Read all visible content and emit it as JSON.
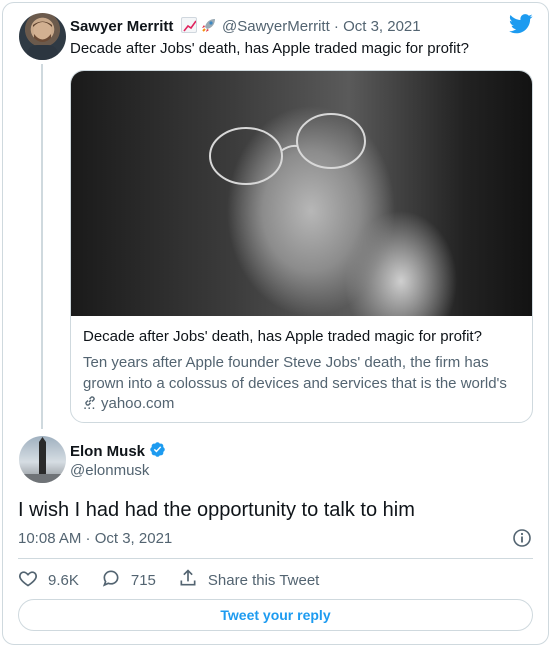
{
  "quoted_tweet": {
    "author_name": "Sawyer Merritt",
    "emoji_icons": [
      "chart-increasing-icon",
      "rocket-icon"
    ],
    "handle_time": "@SawyerMerritt · Oct 3, 2021",
    "text": "Decade after Jobs' death, has Apple traded magic for profit?",
    "link_card": {
      "title": "Decade after Jobs' death, has Apple traded magic for profit?",
      "description": "Ten years after Apple founder Steve Jobs' death, the firm has grown into a colossus of devices and services that is the world's ...",
      "domain": "yahoo.com"
    }
  },
  "main_tweet": {
    "author_name": "Elon Musk",
    "handle": "@elonmusk",
    "text": "I wish I had had the opportunity to talk to him",
    "timestamp": "10:08 AM · Oct 3, 2021"
  },
  "actions": {
    "likes": "9.6K",
    "replies": "715",
    "share_label": "Share this Tweet"
  },
  "reply_button_label": "Tweet your reply",
  "colors": {
    "accent": "#1d9bf0",
    "secondary_text": "#536471",
    "border": "#cfd9de"
  }
}
